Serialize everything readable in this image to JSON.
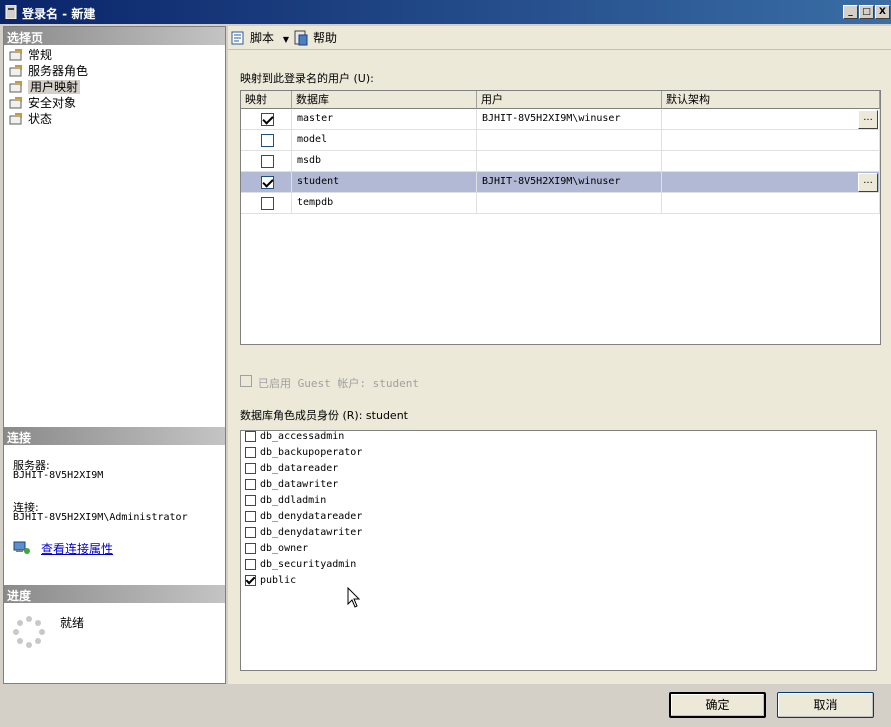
{
  "window": {
    "title": "登录名 - 新建",
    "minimize": "_",
    "maximize": "□",
    "close": "X"
  },
  "left": {
    "select_page_header": "选择页",
    "pages": [
      {
        "label": "常规"
      },
      {
        "label": "服务器角色"
      },
      {
        "label": "用户映射",
        "selected": true
      },
      {
        "label": "安全对象"
      },
      {
        "label": "状态"
      }
    ],
    "connection_header": "连接",
    "server_label": "服务器:",
    "server_value": "BJHIT-8V5H2XI9M",
    "connection_label": "连接:",
    "connection_value": "BJHIT-8V5H2XI9M\\Administrator",
    "view_props_link": "查看连接属性",
    "progress_header": "进度",
    "progress_status": "就绪"
  },
  "toolbar": {
    "script_label": "脚本",
    "help_label": "帮助"
  },
  "mapping": {
    "label": "映射到此登录名的用户 (U):",
    "columns": [
      "映射",
      "数据库",
      "用户",
      "默认架构"
    ],
    "rows": [
      {
        "mapped": true,
        "database": "master",
        "user": "BJHIT-8V5H2XI9M\\winuser",
        "schema": "",
        "selected": false
      },
      {
        "mapped": false,
        "database": "model",
        "user": "",
        "schema": "",
        "selected": false
      },
      {
        "mapped": false,
        "database": "msdb",
        "user": "",
        "schema": "",
        "selected": false
      },
      {
        "mapped": true,
        "database": "student",
        "user": "BJHIT-8V5H2XI9M\\winuser",
        "schema": "",
        "selected": true
      },
      {
        "mapped": false,
        "database": "tempdb",
        "user": "",
        "schema": "",
        "selected": false
      }
    ],
    "dots": "..."
  },
  "guest": {
    "label": "已启用 Guest 帐户: student"
  },
  "roles": {
    "label": "数据库角色成员身份 (R): student",
    "items": [
      {
        "name": "db_accessadmin",
        "checked": false
      },
      {
        "name": "db_backupoperator",
        "checked": false
      },
      {
        "name": "db_datareader",
        "checked": false
      },
      {
        "name": "db_datawriter",
        "checked": false
      },
      {
        "name": "db_ddladmin",
        "checked": false
      },
      {
        "name": "db_denydatareader",
        "checked": false
      },
      {
        "name": "db_denydatawriter",
        "checked": false
      },
      {
        "name": "db_owner",
        "checked": false
      },
      {
        "name": "db_securityadmin",
        "checked": false
      },
      {
        "name": "public",
        "checked": true
      }
    ]
  },
  "buttons": {
    "ok": "确定",
    "cancel": "取消"
  }
}
